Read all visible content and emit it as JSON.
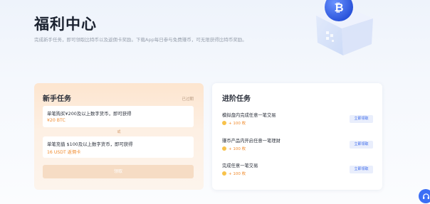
{
  "hero": {
    "title": "福利中心",
    "description": "完成新手任务，即可领取比特币以及返佣卡奖励。下载App每日参与免费赚币，可无限获得比特币奖励。"
  },
  "beginner": {
    "title": "新手任务",
    "corner_link": "已过期",
    "tasks": [
      {
        "text": "单笔购买¥200及以上数字货币，即可获得",
        "reward": "¥20 BTC"
      },
      {
        "text": "单笔充值 $100及以上数字货币，即可获得",
        "reward": "16 USDT 返佣卡"
      }
    ],
    "or_label": "或",
    "claim_label": "领取"
  },
  "advanced": {
    "title": "进阶任务",
    "tasks": [
      {
        "label": "模拟盘内完成任意一笔交易",
        "reward": "+ 100 枚",
        "button": "立即领取"
      },
      {
        "label": "赚币产品内开启任意一笔理财",
        "reward": "+ 100 枚",
        "button": "立即领取"
      },
      {
        "label": "完成任意一笔交易",
        "reward": "+ 100 枚",
        "button": "立即领取"
      }
    ]
  },
  "colors": {
    "accent_blue": "#3867ea",
    "reward_orange": "#f08a2c",
    "beginner_gradient_top": "#fde5cf"
  },
  "icons": [
    "bitcoin-cube-illustration",
    "coin-icon",
    "headset-icon"
  ]
}
